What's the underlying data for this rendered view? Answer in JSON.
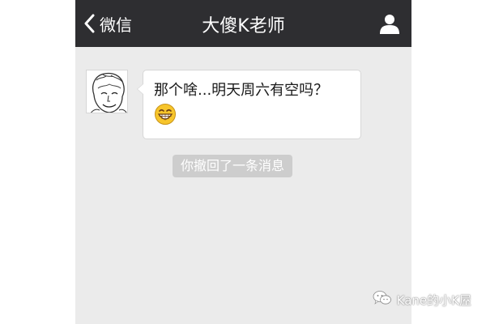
{
  "navbar": {
    "back_label": "微信",
    "title": "大傻K老师",
    "back_icon": "chevron-left-icon",
    "profile_icon": "person-icon"
  },
  "chat": {
    "messages": [
      {
        "text": "那个啥...明天周六有空吗？",
        "emoji": "grinning-face-icon"
      }
    ],
    "system_notice": "你撤回了一条消息"
  },
  "watermark": {
    "text": "Kane的小K屋",
    "icon": "wechat-logo-icon"
  },
  "colors": {
    "navbar_bg": "#2e2e31",
    "chat_bg": "#ebebeb",
    "bubble_bg": "#ffffff",
    "notice_bg": "#cdcdcd"
  }
}
